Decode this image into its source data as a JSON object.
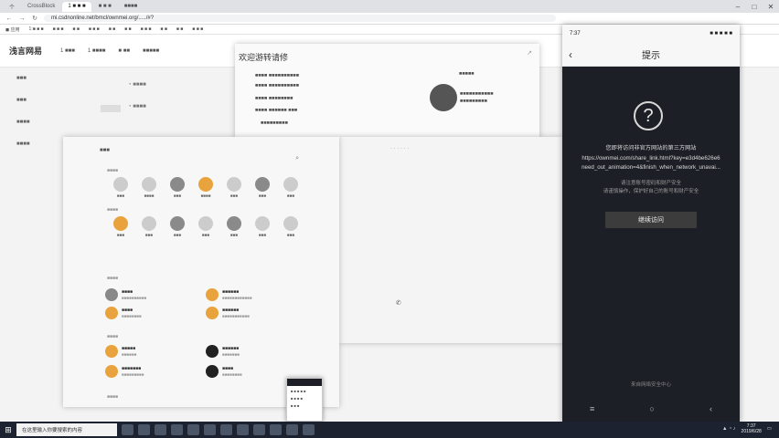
{
  "browser": {
    "tabs": [
      "个",
      "CrossBlock",
      "1 ■ ■ ■",
      "■ ■ ■",
      "■■■■"
    ],
    "url": "mi.csdnonline.net/bmcl/ownmei.org/...../#?",
    "bookmarks": [
      "◼ 应用",
      "1:■ ■ ■",
      "■ ■ ■",
      "■ ■",
      "■ ■ ■",
      "■ ■",
      "■ ■",
      "■ ■ ■",
      "■ ■",
      "■ ■",
      "■ ■ ■"
    ]
  },
  "site": {
    "logo": "浅言网易",
    "nav": [
      "1 ■■■",
      "1 ■■■■",
      "■ ■■",
      "■■■■■"
    ],
    "side": [
      "■■■",
      "■■■",
      "■■■■",
      "■■■■"
    ]
  },
  "top_dialog": {
    "title": "欢迎游转请修"
  },
  "friends_dialog": {
    "header": "■■■"
  },
  "phone": {
    "status_time": "7:37",
    "status_icons": "■ ■ ■ ■ ■",
    "title": "提示",
    "message": "您即将访问非官方网站的第三方网站",
    "url_line1": "https://ownmei.com/share_link.html?key=e3d4be626e6",
    "url_line2": "need_out_animation=4&finish_when_network_unavai...",
    "warning_line1": "请注意账号密码和财产安全",
    "warning_line2": "请谨慎操作，保护好自己的账号和财产安全",
    "continue_button": "继续访问",
    "footer": "来自网络安全中心"
  },
  "taskbar": {
    "search_placeholder": "在这里输入你要搜索的内容",
    "time": "7:37",
    "date": "2019/6/28"
  }
}
